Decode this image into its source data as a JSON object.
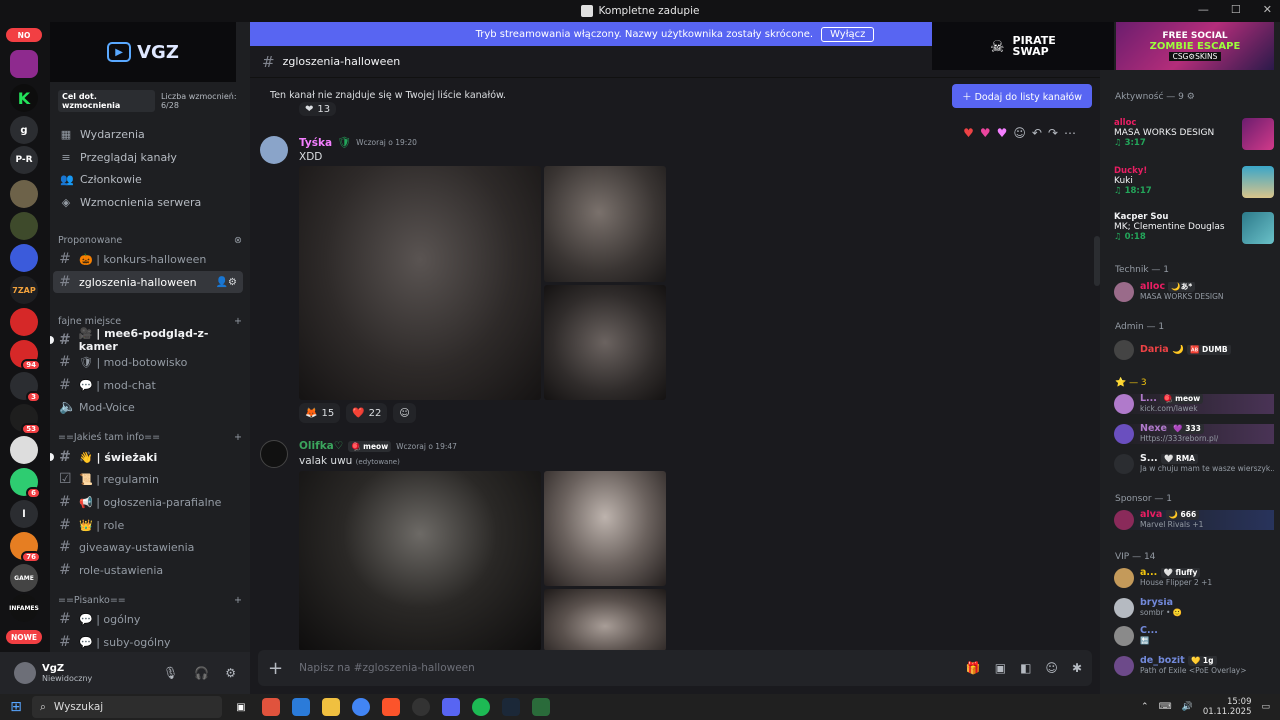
{
  "window": {
    "title": "Kompletne zadupie"
  },
  "banner": {
    "text": "Tryb streamowania włączony. Nazwy użytkownika zostały skrócone.",
    "button": "Wyłącz"
  },
  "guilds": {
    "nowe_top": "NO",
    "nowe_bottom": "NOWE",
    "letters": [
      "K",
      "g",
      "P-R",
      "l"
    ],
    "badges": [
      "94",
      "3",
      "53",
      "6",
      "76"
    ]
  },
  "server": {
    "name": "VGZ",
    "boost_goal": "Cel dot. wzmocnienia",
    "boost_count": "Liczba wzmocnień: 6/28",
    "nav": [
      "Wydarzenia",
      "Przeglądaj kanały",
      "Członkowie",
      "Wzmocnienia serwera"
    ],
    "sections": {
      "suggested": "Proponowane",
      "fajne": "fajne miejsce",
      "info": "==Jakieś tam info==",
      "pisanko": "==Pisanko=="
    },
    "channels": {
      "konkurs": "🎃 | konkurs-halloween",
      "zgloszenia": "zgloszenia-halloween",
      "mee6": "🎥 | mee6-podgląd-z-kamer",
      "botowisko": "🛡 | mod-botowisko",
      "modchat": "💬 | mod-chat",
      "modvoice": "Mod-Voice",
      "swiezaki": "👋 | świeżaki",
      "regulamin": "📜 | regulamin",
      "ogloszenia": "📢 | ogłoszenia-parafialne",
      "role": "👑 | role",
      "giveaway": "giveaway-ustawienia",
      "roleust": "role-ustawienia",
      "ogolny": "💬 | ogólny",
      "suby": "💬 | suby-ogólny"
    }
  },
  "user": {
    "name": "VgZ",
    "status": "Niewidoczny"
  },
  "channel": {
    "name": "zgloszenia-halloween",
    "notice": "Ten kanał nie znajduje się w Twojej liście kanałów.",
    "add_button": "Dodaj do listy kanałów",
    "composer_placeholder": "Napisz na #zgloszenia-halloween"
  },
  "messages": [
    {
      "author": "Tyśka",
      "author_color": "#f47fff",
      "time": "Wczoraj o 19:20",
      "text": "XDD",
      "reactions": [
        {
          "emoji": "🦊",
          "count": "15"
        },
        {
          "emoji": "❤️",
          "count": "22"
        }
      ]
    },
    {
      "author": "Olifka♡",
      "author_color": "#3ba55d",
      "tag": "🪀 meow",
      "time": "Wczoraj o 19:47",
      "text": "valak uwu",
      "edited": "(edytowane)"
    }
  ],
  "prev_reaction_count": "13",
  "members": {
    "ad1_line1": "PIRATE",
    "ad1_line2": "SWAP",
    "ad2_line1": "FREE SOCIAL",
    "ad2_line2": "ZOMBIE ESCAPE",
    "ad2_line3": "CSG⚙SKINS",
    "activity_header": "Aktywność — 9",
    "activities": [
      {
        "name": "alloc",
        "title": "MASA WORKS DESIGN",
        "time": "3:17",
        "color": "#e91e63"
      },
      {
        "name": "Ducky!",
        "title": "Kuki",
        "time": "18:17",
        "color": "#e91e63"
      },
      {
        "name": "Kacper Sou",
        "title": "MK; Clementine Douglas",
        "time": "0:18",
        "color": "#f2f3f5"
      }
    ],
    "groups": [
      {
        "header": "Technik — 1",
        "rows": [
          {
            "name": "alloc",
            "tag": "🌙あ*",
            "status": "MASA WORKS DESIGN",
            "color": "#e91e63"
          }
        ]
      },
      {
        "header": "Admin — 1",
        "rows": [
          {
            "name": "Daria 🌙",
            "tag": "🆎 DUMB",
            "status": "",
            "color": "#ed4245"
          }
        ]
      },
      {
        "header": "⭐ — 3",
        "rows": [
          {
            "name": "L...",
            "tag": "🪀 meow",
            "status": "kick.com/lawek",
            "color": "#9b59b6"
          },
          {
            "name": "Nexe",
            "tag": "💜 333",
            "status": "Https://333reborn.pl/",
            "color": "#9b59b6"
          },
          {
            "name": "S...",
            "tag": "🤍 RMA",
            "status": "Ja w chuju mam te wasze wierszyk...",
            "color": "#f2f3f5"
          }
        ]
      },
      {
        "header": "Sponsor — 1",
        "rows": [
          {
            "name": "alva",
            "tag": "🌙 666",
            "status": "Marvel Rivals +1",
            "color": "#e91e63"
          }
        ]
      },
      {
        "header": "VIP — 14",
        "rows": [
          {
            "name": "a...",
            "tag": "🤍 fluffy",
            "status": "House Flipper 2 +1",
            "color": "#f1c40f"
          },
          {
            "name": "brysia",
            "tag": "",
            "status": "sombr • 🙂",
            "color": "#7289da"
          },
          {
            "name": "C...",
            "tag": "",
            "status": "🔚",
            "color": "#7289da"
          },
          {
            "name": "de_bozit",
            "tag": "💛 1g",
            "status": "Path of Exile <PoE Overlay>",
            "color": "#7289da"
          }
        ]
      }
    ]
  },
  "taskbar": {
    "search": "Wyszukaj",
    "time": "15:09",
    "date": "01.11.2025"
  }
}
